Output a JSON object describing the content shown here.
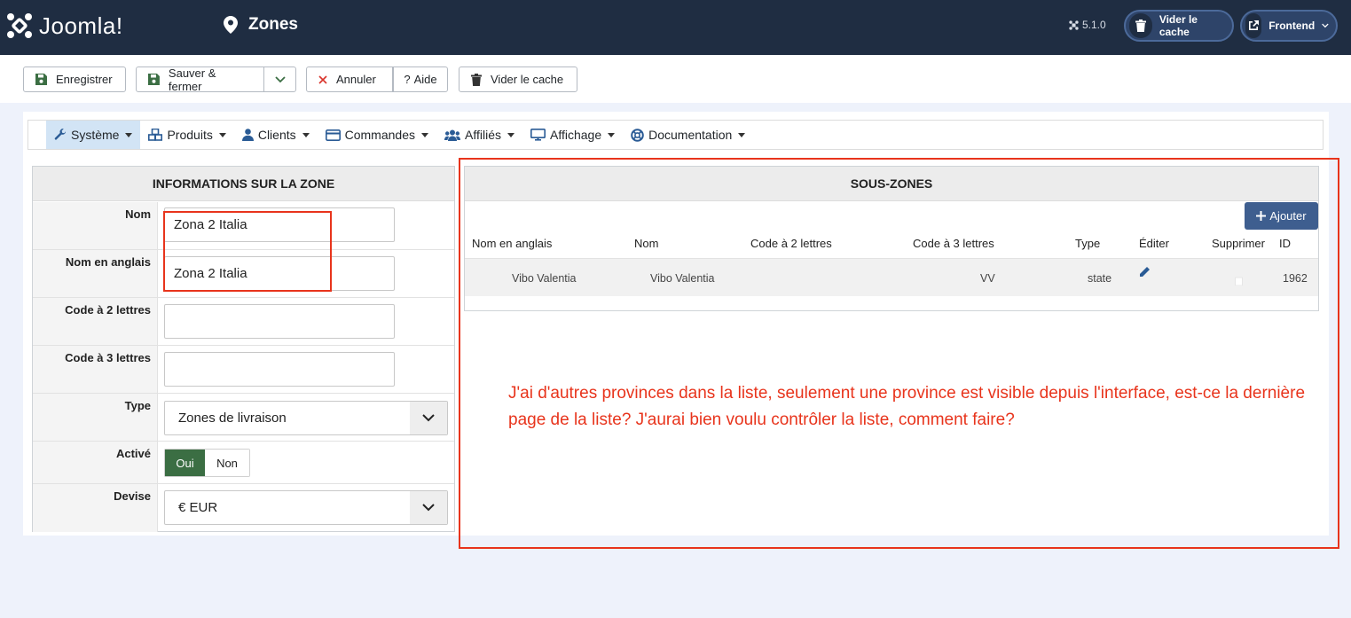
{
  "header": {
    "logo_text": "Joomla!",
    "page_title": "Zones",
    "version": "5.1.0",
    "clear_cache_label": "Vider le cache",
    "frontend_label": "Frontend"
  },
  "toolbar": {
    "save_label": "Enregistrer",
    "save_close_label": "Sauver & fermer",
    "cancel_label": "Annuler",
    "help_label": "Aide",
    "clear_cache_label": "Vider le cache"
  },
  "menu": {
    "items": [
      {
        "label": "Système",
        "icon": "wrench-icon"
      },
      {
        "label": "Produits",
        "icon": "cubes-icon"
      },
      {
        "label": "Clients",
        "icon": "user-icon"
      },
      {
        "label": "Commandes",
        "icon": "credit-card-icon"
      },
      {
        "label": "Affiliés",
        "icon": "users-icon"
      },
      {
        "label": "Affichage",
        "icon": "desktop-icon"
      },
      {
        "label": "Documentation",
        "icon": "lifebuoy-icon"
      }
    ]
  },
  "zone_form": {
    "title": "INFORMATIONS SUR LA ZONE",
    "name_label": "Nom",
    "name_value": "Zona 2 Italia",
    "english_name_label": "Nom en anglais",
    "english_name_value": "Zona 2 Italia",
    "code2_label": "Code à 2 lettres",
    "code2_value": "",
    "code3_label": "Code à 3 lettres",
    "code3_value": "",
    "type_label": "Type",
    "type_value": "Zones de livraison",
    "active_label": "Activé",
    "active_yes": "Oui",
    "active_no": "Non",
    "currency_label": "Devise",
    "currency_value": "€ EUR"
  },
  "subzones": {
    "title": "SOUS-ZONES",
    "add_label": "Ajouter",
    "columns": [
      "Nom en anglais",
      "Nom",
      "Code à 2 lettres",
      "Code à 3 lettres",
      "Type",
      "Éditer",
      "Supprimer",
      "ID"
    ],
    "rows": [
      {
        "english_name": "Vibo Valentia",
        "name": "Vibo Valentia",
        "code2": "",
        "code3": "VV",
        "type": "state",
        "id": "1962"
      }
    ]
  },
  "annotation": {
    "text": "J'ai d'autres provinces dans la liste, seulement une province est visible depuis l'interface, est-ce la dernière page de la liste? J'aurai bien voulu contrôler la liste, comment faire?"
  },
  "colors": {
    "header_bg": "#1f2d42",
    "toggle_active": "#3b6e43",
    "add_button": "#3e5e8f",
    "annotation_red": "#e8341c"
  }
}
